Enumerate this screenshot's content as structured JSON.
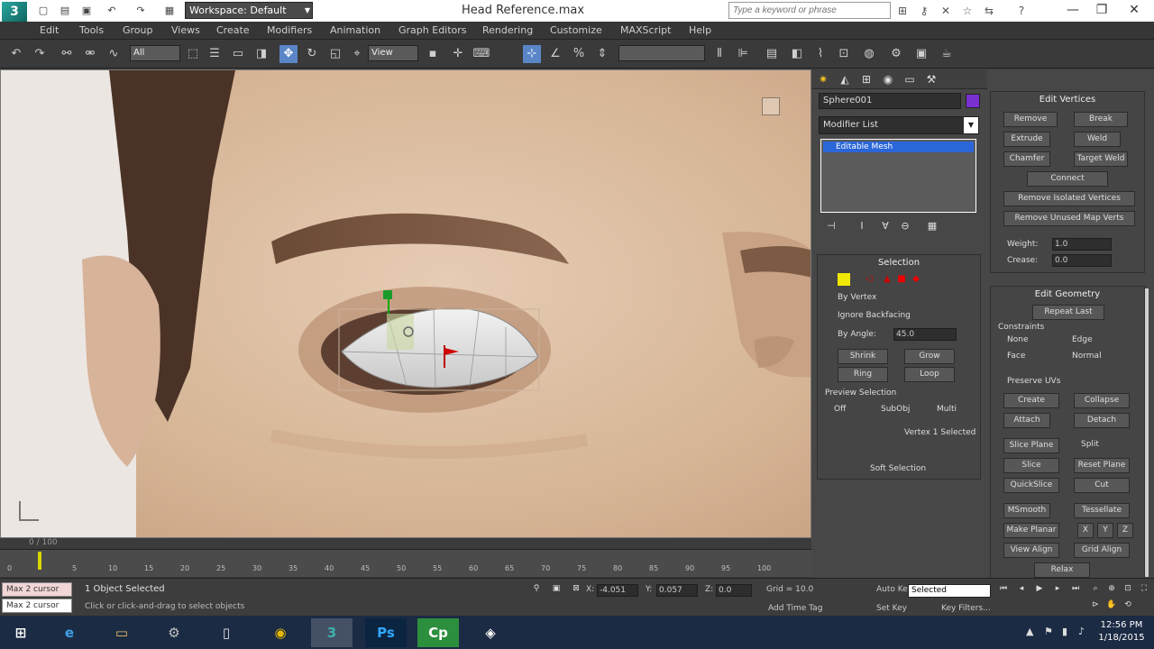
{
  "titlebar": {
    "workspace": "Workspace: Default",
    "document_title": "Head Reference.max",
    "search_placeholder": "Type a keyword or phrase",
    "minimize": "—",
    "maximize": "❐",
    "close": "✕"
  },
  "menu": [
    "Edit",
    "Tools",
    "Group",
    "Views",
    "Create",
    "Modifiers",
    "Animation",
    "Graph Editors",
    "Rendering",
    "Customize",
    "MAXScript",
    "Help"
  ],
  "toolbar": {
    "selection_filter": "All",
    "ref_coord": "View"
  },
  "command_panel": {
    "object_name": "Sphere001",
    "object_color": "#7a2fd0",
    "modifier_list": "Modifier List",
    "stack_item": "Editable Mesh",
    "edit_vertices": {
      "title": "Edit Vertices",
      "remove": "Remove",
      "break": "Break",
      "extrude": "Extrude",
      "weld": "Weld",
      "chamfer": "Chamfer",
      "target_weld": "Target Weld",
      "connect": "Connect",
      "remove_isolated": "Remove Isolated Vertices",
      "remove_unused_map": "Remove Unused Map Verts",
      "weight_label": "Weight:",
      "weight_value": "1.0",
      "crease_label": "Crease:",
      "crease_value": "0.0"
    },
    "selection": {
      "title": "Selection",
      "by_vertex": "By Vertex",
      "ignore_backfacing": "Ignore Backfacing",
      "by_angle": "By Angle:",
      "by_angle_value": "45.0",
      "shrink": "Shrink",
      "grow": "Grow",
      "ring": "Ring",
      "loop": "Loop",
      "preview_selection": "Preview Selection",
      "off": "Off",
      "subobj": "SubObj",
      "multi": "Multi",
      "status": "Vertex 1 Selected",
      "soft_selection": "Soft Selection"
    },
    "edit_geometry": {
      "title": "Edit Geometry",
      "repeat_last": "Repeat Last",
      "constraints": "Constraints",
      "none": "None",
      "edge": "Edge",
      "face": "Face",
      "normal": "Normal",
      "preserve_uvs": "Preserve UVs",
      "create": "Create",
      "collapse": "Collapse",
      "attach": "Attach",
      "detach": "Detach",
      "slice_plane": "Slice Plane",
      "split": "Split",
      "slice": "Slice",
      "reset_plane": "Reset Plane",
      "quickslice": "QuickSlice",
      "cut": "Cut",
      "msmooth": "MSmooth",
      "tessellate": "Tessellate",
      "make_planar": "Make Planar",
      "x": "X",
      "y": "Y",
      "z": "Z",
      "view_align": "View Align",
      "grid_align": "Grid Align",
      "relax": "Relax"
    }
  },
  "timeline": {
    "slider_label": "0 / 100",
    "ticks": [
      "0",
      "5",
      "10",
      "15",
      "20",
      "25",
      "30",
      "35",
      "40",
      "45",
      "50",
      "55",
      "60",
      "65",
      "70",
      "75",
      "80",
      "85",
      "90",
      "95",
      "100"
    ]
  },
  "status": {
    "maxscript_label": "Max 2 cursor",
    "maxscript_label2": "Max 2 cursor",
    "selection": "1 Object Selected",
    "prompt": "Click or click-and-drag to select objects",
    "x_label": "X:",
    "x_value": "-4.051",
    "y_label": "Y:",
    "y_value": "0.057",
    "z_label": "Z:",
    "z_value": "0.0",
    "grid": "Grid = 10.0",
    "auto_key": "Auto Key",
    "set_key": "Set Key",
    "key_filters": "Key Filters...",
    "add_time_tag": "Add Time Tag",
    "selected_dropdown": "Selected"
  },
  "taskbar": {
    "time": "12:56 PM",
    "date": "1/18/2015"
  }
}
